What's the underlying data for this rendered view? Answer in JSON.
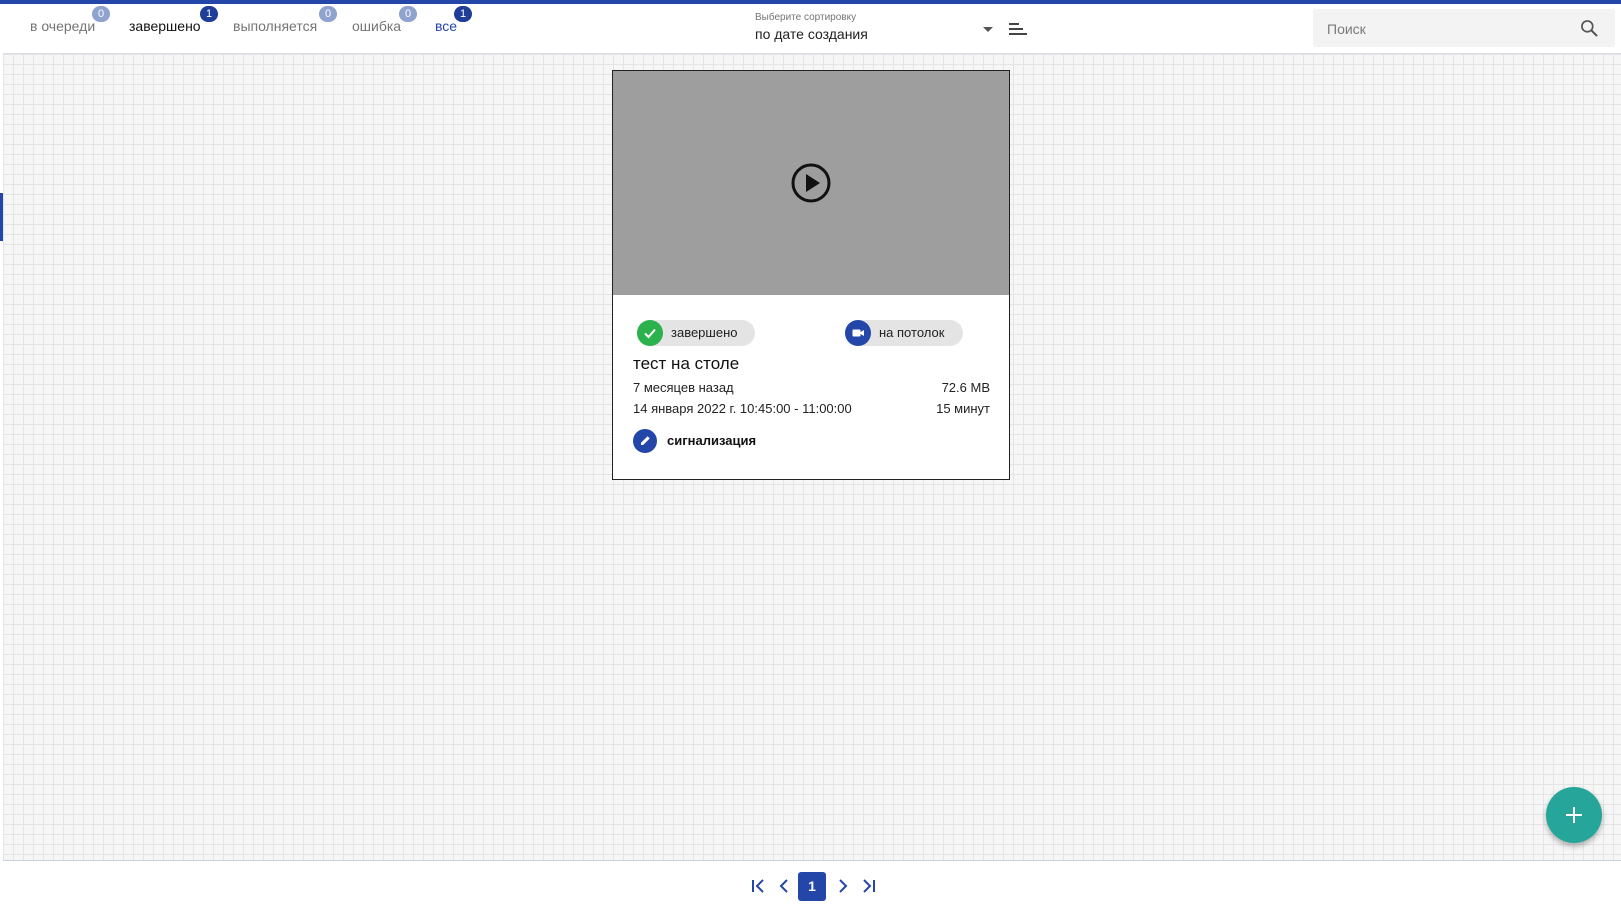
{
  "tabs": [
    {
      "label": "в очереди",
      "count": "0"
    },
    {
      "label": "завершено",
      "count": "1"
    },
    {
      "label": "выполняется",
      "count": "0"
    },
    {
      "label": "ошибка",
      "count": "0"
    },
    {
      "label": "все",
      "count": "1"
    }
  ],
  "sort": {
    "label": "Выберите сортировку",
    "value": "по дате создания"
  },
  "search": {
    "placeholder": "Поиск"
  },
  "card": {
    "status": "завершено",
    "camera": "на потолок",
    "title": "тест на столе",
    "relative_time": "7 месяцев назад",
    "size": "72.6 MB",
    "date_range": "14 января 2022 г. 10:45:00 - 11:00:00",
    "duration": "15 минут",
    "tag": "сигнализация"
  },
  "pagination": {
    "current_page": "1"
  },
  "colors": {
    "accent": "#2346a8",
    "success": "#2bb24c",
    "fab": "#26a69a",
    "thumbnail": "#9e9e9e"
  },
  "icons": {
    "play": "play-circle-icon",
    "status": "check-icon",
    "camera": "videocam-icon",
    "edit": "pencil-icon",
    "sort_order": "sort-lines-icon",
    "search": "search-icon",
    "fab": "plus-icon"
  }
}
